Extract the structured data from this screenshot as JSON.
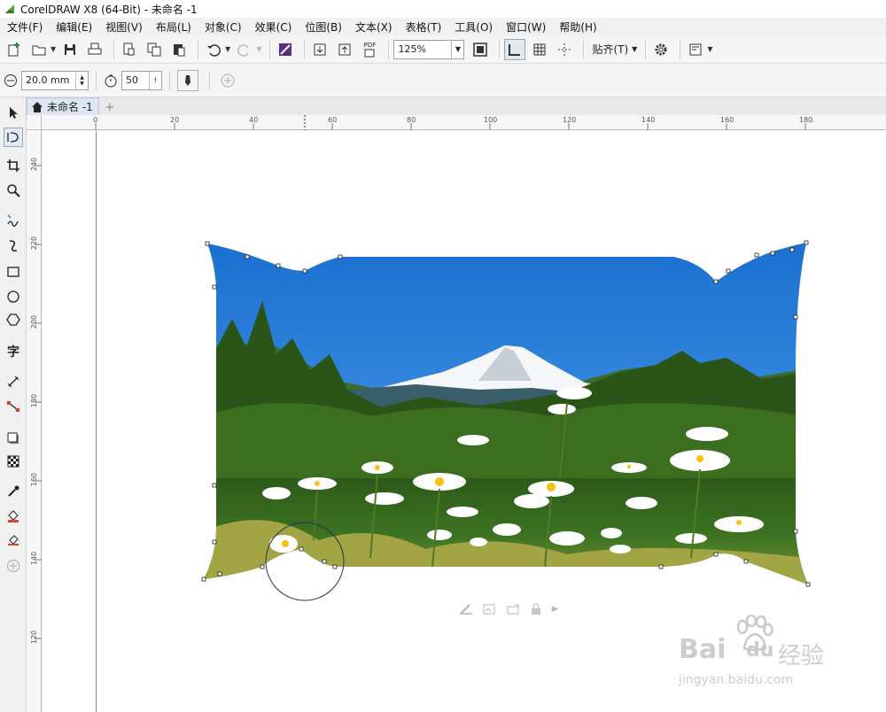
{
  "window": {
    "title": "CorelDRAW X8 (64-Bit) - 未命名 -1"
  },
  "menu": [
    "文件(F)",
    "编辑(E)",
    "视图(V)",
    "布局(L)",
    "对象(C)",
    "效果(C)",
    "位图(B)",
    "文本(X)",
    "表格(T)",
    "工具(O)",
    "窗口(W)",
    "帮助(H)"
  ],
  "toolbar": {
    "zoom_value": "125%",
    "snap_label": "贴齐(T)",
    "pdf_label": "PDF"
  },
  "propbar": {
    "size_value": "20.0 mm",
    "pressure_value": "50"
  },
  "document": {
    "tab_label": "未命名 -1"
  },
  "rulers": {
    "h_ticks": [
      "0",
      "20",
      "40",
      "60",
      "80",
      "100",
      "120",
      "140",
      "160",
      "180"
    ],
    "v_ticks": [
      "240",
      "220",
      "200",
      "180",
      "160",
      "140",
      "120"
    ]
  },
  "watermark": {
    "brand": "Bai",
    "brand2": "du",
    "cn": "经验",
    "url": "jingyan.baidu.com"
  },
  "colors": {
    "sky": "#2d7fd6",
    "accent_green": "#3a6b1f",
    "selection_handle": "#222222"
  }
}
